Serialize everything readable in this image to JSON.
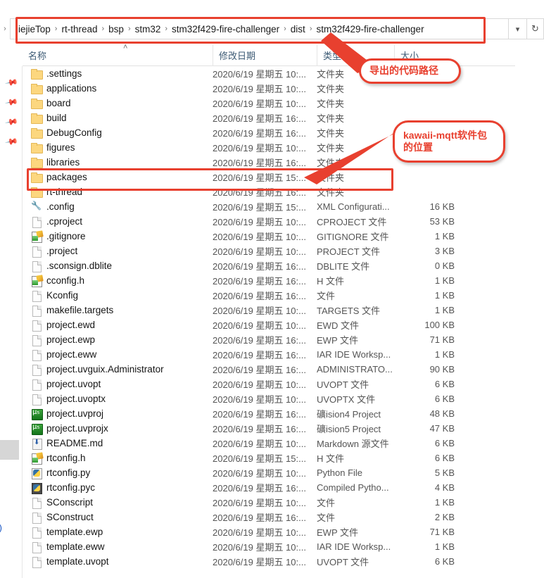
{
  "window": {
    "title": "stm32f429-fire-challenger"
  },
  "address_bar": {
    "back_chevron": "chevron-right",
    "crumbs": [
      "jiejieTop",
      "rt-thread",
      "bsp",
      "stm32",
      "stm32f429-fire-challenger",
      "dist",
      "stm32f429-fire-challenger"
    ],
    "separator": "›",
    "dropdown_icon": "chevron-down-icon",
    "refresh_icon": "refresh-icon"
  },
  "columns": {
    "name": "名称",
    "date": "修改日期",
    "type": "类型",
    "size": "大小",
    "sort_caret": "˄"
  },
  "nav_pane": {
    "pin_icon": "pin-icon",
    "pin_count": 4
  },
  "files": [
    {
      "name": ".settings",
      "icon": "folder",
      "date": "2020/6/19 星期五 10:...",
      "type": "文件夹",
      "size": ""
    },
    {
      "name": "applications",
      "icon": "folder",
      "date": "2020/6/19 星期五 10:...",
      "type": "文件夹",
      "size": ""
    },
    {
      "name": "board",
      "icon": "folder",
      "date": "2020/6/19 星期五 10:...",
      "type": "文件夹",
      "size": ""
    },
    {
      "name": "build",
      "icon": "folder",
      "date": "2020/6/19 星期五 16:...",
      "type": "文件夹",
      "size": ""
    },
    {
      "name": "DebugConfig",
      "icon": "folder",
      "date": "2020/6/19 星期五 16:...",
      "type": "文件夹",
      "size": ""
    },
    {
      "name": "figures",
      "icon": "folder",
      "date": "2020/6/19 星期五 10:...",
      "type": "文件夹",
      "size": ""
    },
    {
      "name": "libraries",
      "icon": "folder",
      "date": "2020/6/19 星期五 16:...",
      "type": "文件夹",
      "size": ""
    },
    {
      "name": "packages",
      "icon": "folder",
      "date": "2020/6/19 星期五 15:...",
      "type": "文件夹",
      "size": ""
    },
    {
      "name": "rt-thread",
      "icon": "folder",
      "date": "2020/6/19 星期五 16:...",
      "type": "文件夹",
      "size": ""
    },
    {
      "name": ".config",
      "icon": "config",
      "date": "2020/6/19 星期五 15:...",
      "type": "XML Configurati...",
      "size": "16 KB"
    },
    {
      "name": ".cproject",
      "icon": "file",
      "date": "2020/6/19 星期五 10:...",
      "type": "CPROJECT 文件",
      "size": "53 KB"
    },
    {
      "name": ".gitignore",
      "icon": "text",
      "date": "2020/6/19 星期五 10:...",
      "type": "GITIGNORE 文件",
      "size": "1 KB"
    },
    {
      "name": ".project",
      "icon": "file",
      "date": "2020/6/19 星期五 10:...",
      "type": "PROJECT 文件",
      "size": "3 KB"
    },
    {
      "name": ".sconsign.dblite",
      "icon": "file",
      "date": "2020/6/19 星期五 16:...",
      "type": "DBLITE 文件",
      "size": "0 KB"
    },
    {
      "name": "cconfig.h",
      "icon": "text",
      "date": "2020/6/19 星期五 16:...",
      "type": "H 文件",
      "size": "1 KB"
    },
    {
      "name": "Kconfig",
      "icon": "file",
      "date": "2020/6/19 星期五 16:...",
      "type": "文件",
      "size": "1 KB"
    },
    {
      "name": "makefile.targets",
      "icon": "file",
      "date": "2020/6/19 星期五 10:...",
      "type": "TARGETS 文件",
      "size": "1 KB"
    },
    {
      "name": "project.ewd",
      "icon": "file",
      "date": "2020/6/19 星期五 10:...",
      "type": "EWD 文件",
      "size": "100 KB"
    },
    {
      "name": "project.ewp",
      "icon": "file",
      "date": "2020/6/19 星期五 16:...",
      "type": "EWP 文件",
      "size": "71 KB"
    },
    {
      "name": "project.eww",
      "icon": "file",
      "date": "2020/6/19 星期五 16:...",
      "type": "IAR IDE Worksp...",
      "size": "1 KB"
    },
    {
      "name": "project.uvguix.Administrator",
      "icon": "file",
      "date": "2020/6/19 星期五 16:...",
      "type": "ADMINISTRATO...",
      "size": "90 KB"
    },
    {
      "name": "project.uvopt",
      "icon": "file",
      "date": "2020/6/19 星期五 10:...",
      "type": "UVOPT 文件",
      "size": "6 KB"
    },
    {
      "name": "project.uvoptx",
      "icon": "file",
      "date": "2020/6/19 星期五 10:...",
      "type": "UVOPTX 文件",
      "size": "6 KB"
    },
    {
      "name": "project.uvproj",
      "icon": "uv",
      "date": "2020/6/19 星期五 16:...",
      "type": "礦ision4 Project",
      "size": "48 KB"
    },
    {
      "name": "project.uvprojx",
      "icon": "uv",
      "date": "2020/6/19 星期五 16:...",
      "type": "礦ision5 Project",
      "size": "47 KB"
    },
    {
      "name": "README.md",
      "icon": "md",
      "date": "2020/6/19 星期五 10:...",
      "type": "Markdown 源文件",
      "size": "6 KB"
    },
    {
      "name": "rtconfig.h",
      "icon": "text",
      "date": "2020/6/19 星期五 15:...",
      "type": "H 文件",
      "size": "6 KB"
    },
    {
      "name": "rtconfig.py",
      "icon": "py",
      "date": "2020/6/19 星期五 10:...",
      "type": "Python File",
      "size": "5 KB"
    },
    {
      "name": "rtconfig.pyc",
      "icon": "pyc",
      "date": "2020/6/19 星期五 16:...",
      "type": "Compiled Pytho...",
      "size": "4 KB"
    },
    {
      "name": "SConscript",
      "icon": "file",
      "date": "2020/6/19 星期五 10:...",
      "type": "文件",
      "size": "1 KB"
    },
    {
      "name": "SConstruct",
      "icon": "file",
      "date": "2020/6/19 星期五 16:...",
      "type": "文件",
      "size": "2 KB"
    },
    {
      "name": "template.ewp",
      "icon": "file",
      "date": "2020/6/19 星期五 10:...",
      "type": "EWP 文件",
      "size": "71 KB"
    },
    {
      "name": "template.eww",
      "icon": "file",
      "date": "2020/6/19 星期五 10:...",
      "type": "IAR IDE Worksp...",
      "size": "1 KB"
    },
    {
      "name": "template.uvopt",
      "icon": "file",
      "date": "2020/6/19 星期五 10:...",
      "type": "UVOPT 文件",
      "size": "6 KB"
    }
  ],
  "annotations": {
    "accent_color": "#e8402f",
    "path_callout": {
      "text": "导出的代码路径"
    },
    "packages_callout": {
      "line1": "kawaii-mqtt软件包",
      "line2": "的位置"
    }
  }
}
